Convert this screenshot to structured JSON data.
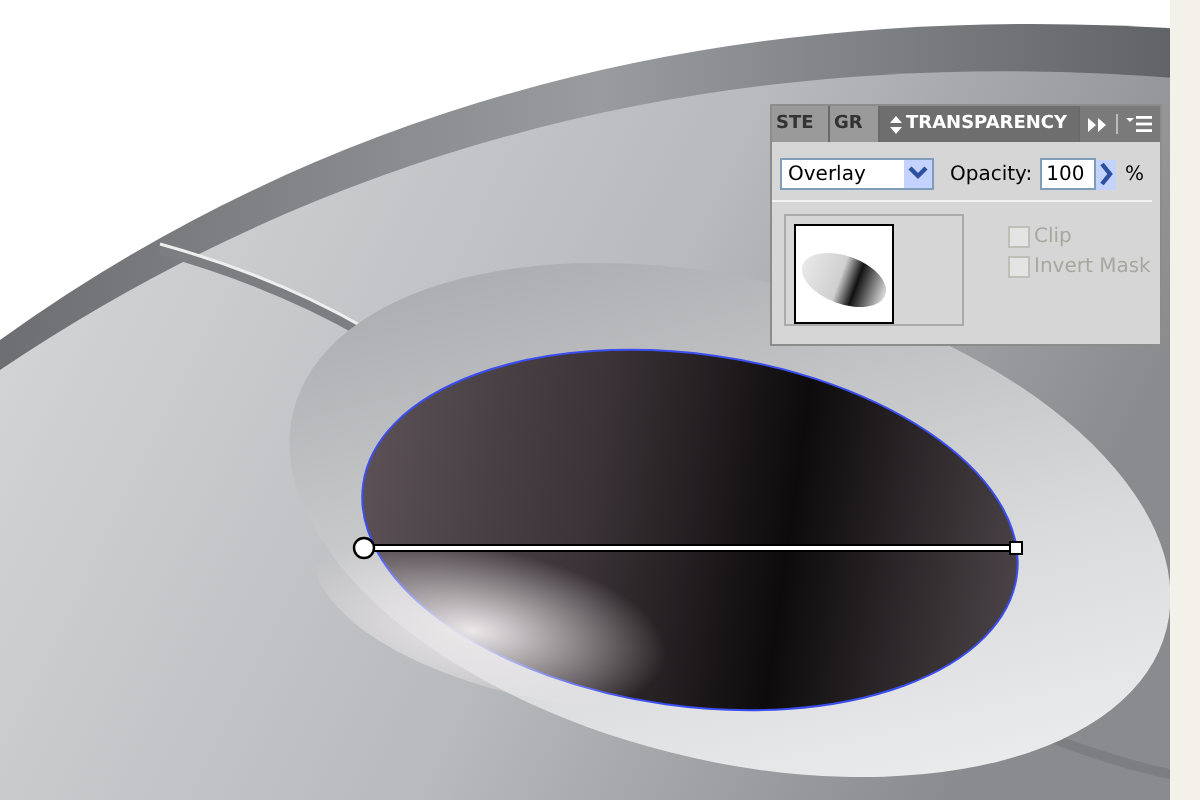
{
  "panel": {
    "tabs": [
      {
        "label": "STE",
        "selected": false
      },
      {
        "label": "GR",
        "selected": false
      },
      {
        "label": "TRANSPARENCY",
        "selected": true
      }
    ],
    "blend_mode": {
      "value": "Overlay"
    },
    "opacity": {
      "label": "Opacity:",
      "value": "100",
      "unit": "%"
    },
    "checkboxes": [
      {
        "label": "Clip",
        "checked": false,
        "disabled": true
      },
      {
        "label": "Invert Mask",
        "checked": false,
        "disabled": true
      }
    ]
  }
}
